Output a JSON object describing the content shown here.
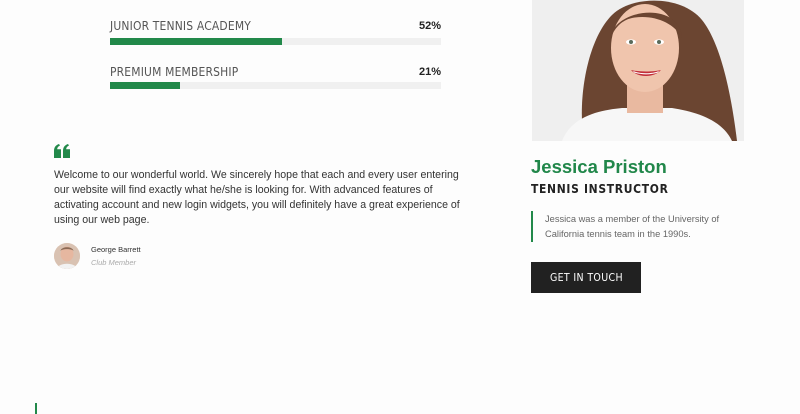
{
  "skills": [
    {
      "label": "JUNIOR TENNIS ACADEMY",
      "percent_label": "52%",
      "value": 52
    },
    {
      "label": "PREMIUM MEMBERSHIP",
      "percent_label": "21%",
      "value": 21
    }
  ],
  "testimonial": {
    "quote_icon": "quote-icon",
    "text": "Welcome to our wonderful world. We sincerely hope that each and every user entering our website will find exactly what he/she is looking for. With advanced features of activating account and new login widgets, you will definitely have a great experience of using our web page.",
    "author_name": "George Barrett",
    "author_role": "Club Member"
  },
  "profile": {
    "name": "Jessica Priston",
    "role": "TENNIS INSTRUCTOR",
    "bio": "Jessica was a member of the University of California tennis team in the 1990s.",
    "cta_label": "GET IN TOUCH"
  },
  "colors": {
    "accent": "#22894a",
    "dark_button": "#212121",
    "track": "#f0f0f0"
  }
}
